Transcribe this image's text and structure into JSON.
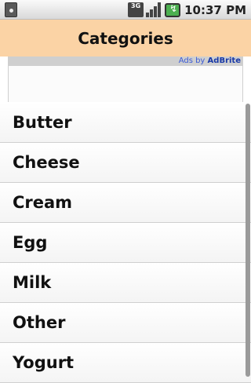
{
  "status_bar": {
    "network_label": "3G",
    "time": "10:37 PM",
    "icons": [
      "sd-card-icon",
      "3g-icon",
      "signal-icon",
      "battery-icon"
    ]
  },
  "header": {
    "title": "Categories",
    "background_color": "#fbd3a5"
  },
  "ad": {
    "ads_text": "Ads by",
    "brand_text": "AdBrite"
  },
  "categories": [
    "Butter",
    "Cheese",
    "Cream",
    "Egg",
    "Milk",
    "Other",
    "Yogurt"
  ]
}
